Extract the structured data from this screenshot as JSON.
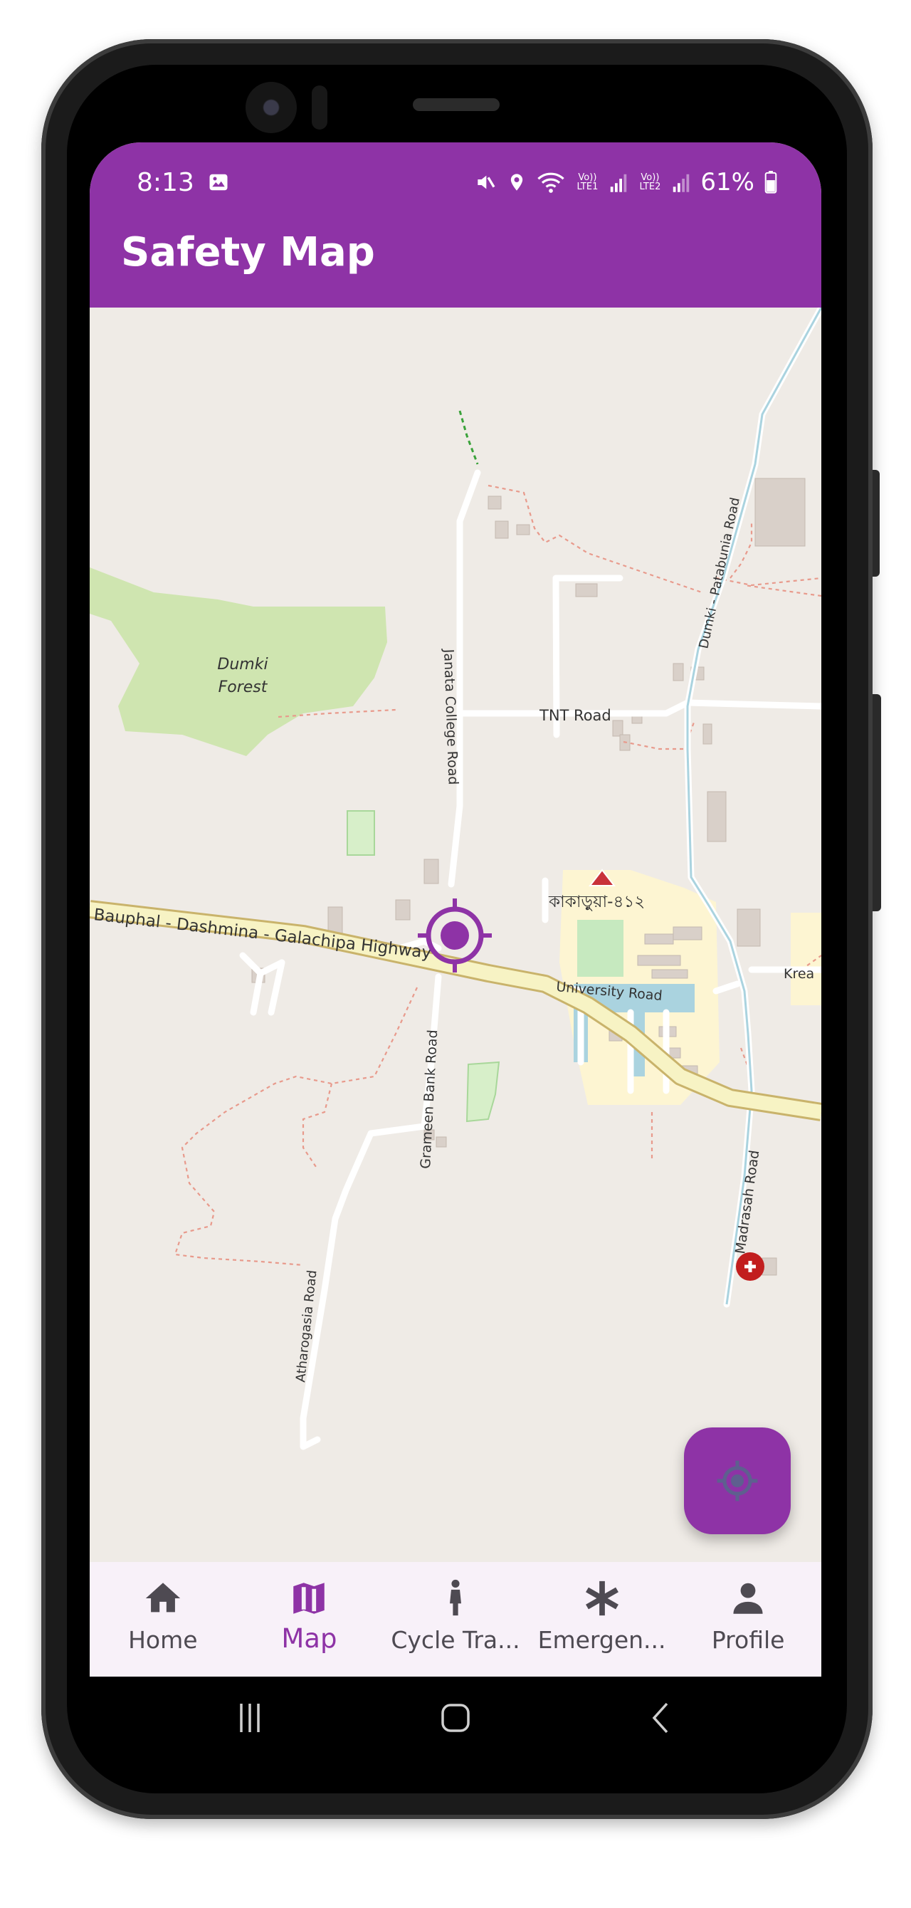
{
  "status_bar": {
    "time": "8:13",
    "battery": "61%",
    "icons": [
      "gallery-icon",
      "mute-icon",
      "location-icon",
      "wifi-icon",
      "volte-lte1-signal-icon",
      "volte-lte2-signal-icon",
      "battery-icon"
    ],
    "volte1": "Vo)) LTE1",
    "volte2": "Vo)) LTE2"
  },
  "app_bar": {
    "title": "Safety Map"
  },
  "map": {
    "labels": {
      "forest": [
        "Dumki",
        "Forest"
      ],
      "tnt_road": "TNT Road",
      "janata_college_road": "Janata College Road",
      "dumki_patabunia_road": "Dumki - Patabunia Road",
      "highway": "Bauphal - Dashmina - Galachipa Highway",
      "university_road": "University Road",
      "kreak": "Krea",
      "grameen_bank_road": "Grameen Bank Road",
      "atharogasia_road": "Atharogasia Road",
      "madrasah_road": "Madrasah Road",
      "place_bn": "কাকাড়ুয়া-৪১২"
    },
    "markers": [
      "current-location-marker",
      "hospital-marker",
      "place-marker"
    ]
  },
  "fab": {
    "icon": "my-location-icon"
  },
  "bottom_nav": {
    "items": [
      {
        "label": "Home",
        "icon": "home-icon",
        "active": false
      },
      {
        "label": "Map",
        "icon": "map-icon",
        "active": true
      },
      {
        "label": "Cycle Tra...",
        "icon": "person-icon",
        "active": false
      },
      {
        "label": "Emergen...",
        "icon": "asterisk-icon",
        "active": false
      },
      {
        "label": "Profile",
        "icon": "profile-icon",
        "active": false
      }
    ]
  },
  "system_nav": {
    "buttons": [
      "recents-button",
      "home-button",
      "back-button"
    ]
  },
  "colors": {
    "accent": "#8e33a6",
    "nav_bg": "#f8f1f9",
    "map_bg": "#efebe6"
  }
}
